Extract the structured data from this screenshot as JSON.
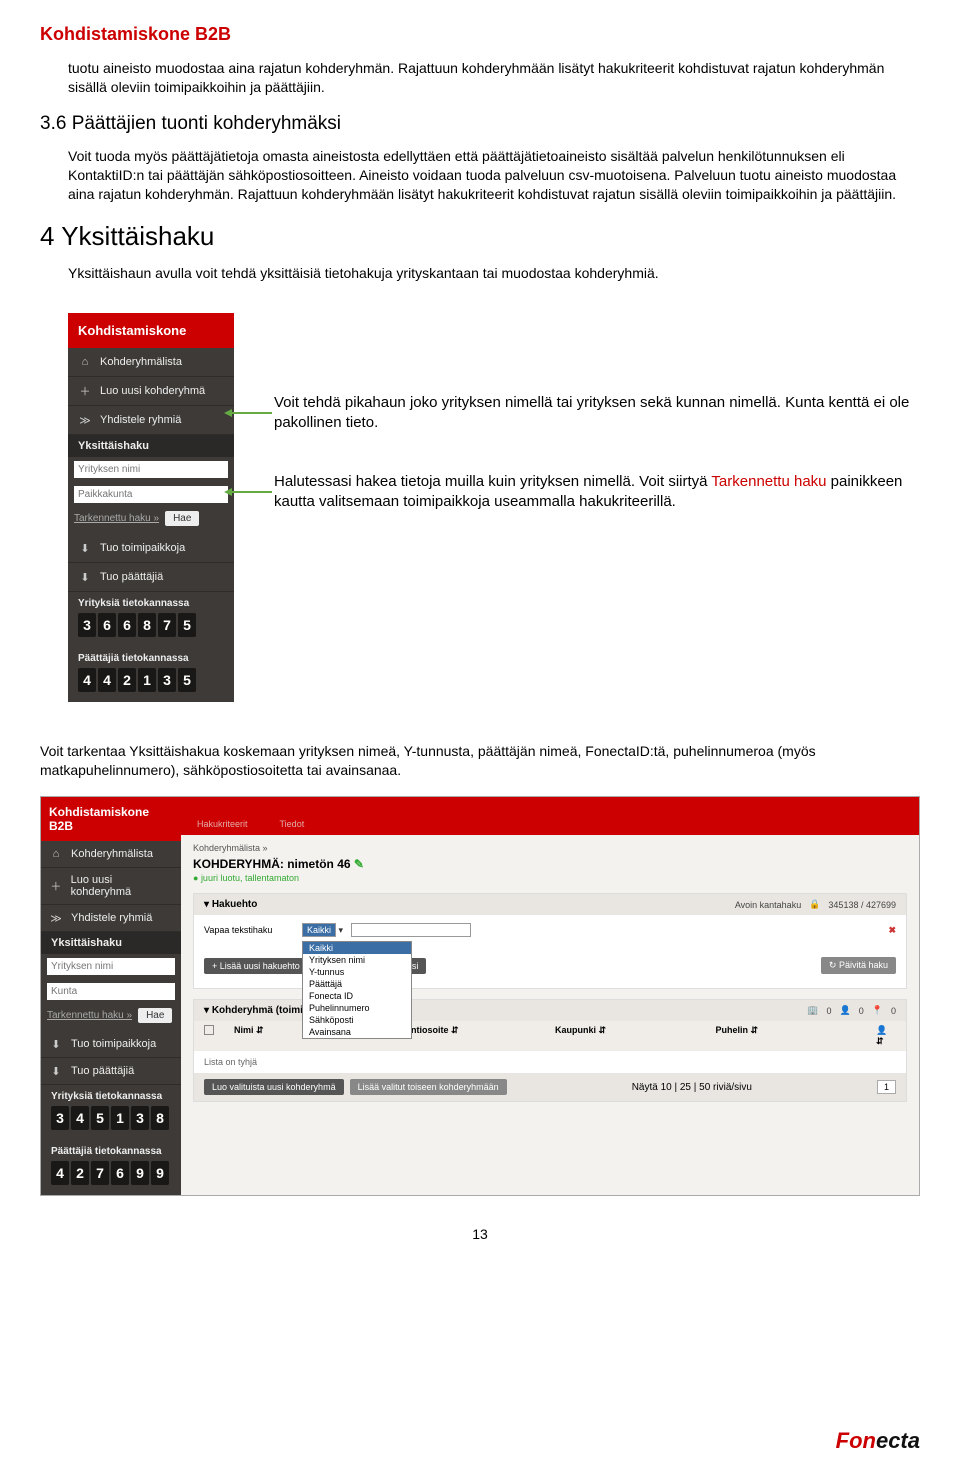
{
  "doc_title": "Kohdistamiskone B2B",
  "para1": "tuotu aineisto muodostaa aina rajatun kohderyhmän. Rajattuun kohderyhmään lisätyt hakukriteerit kohdistuvat rajatun kohderyhmän sisällä oleviin toimipaikkoihin ja päättäjiin.",
  "sec36_title": "3.6 Päättäjien tuonti kohderyhmäksi",
  "para2": "Voit tuoda myös päättäjätietoja omasta aineistosta edellyttäen että päättäjätietoaineisto sisältää palvelun henkilötunnuksen eli KontaktiID:n tai päättäjän sähköpostiosoitteen. Aineisto voidaan tuoda palveluun csv-muotoisena. Palveluun tuotu aineisto muodostaa aina rajatun kohderyhmän. Rajattuun kohderyhmään lisätyt hakukriteerit kohdistuvat rajatun sisällä oleviin toimipaikkoihin ja päättäjiin.",
  "sec4_title": "4 Yksittäishaku",
  "para3": "Yksittäishaun avulla voit tehdä yksittäisiä tietohakuja yrityskantaan tai muodostaa kohderyhmiä.",
  "sidebar": {
    "header": "Kohdistamiskone",
    "items": [
      {
        "icon": "home",
        "label": "Kohderyhmälista"
      },
      {
        "icon": "plus",
        "label": "Luo uusi kohderyhmä"
      },
      {
        "icon": "merge",
        "label": "Yhdistele ryhmiä"
      }
    ],
    "search_label": "Yksittäishaku",
    "input1_placeholder": "Yrityksen nimi",
    "input2_placeholder": "Paikkakunta",
    "adv_link": "Tarkennettu haku »",
    "search_btn": "Hae",
    "items2": [
      {
        "icon": "import",
        "label": "Tuo toimipaikkoja"
      },
      {
        "icon": "import",
        "label": "Tuo päättäjiä"
      }
    ],
    "counter1_label": "Yrityksiä tietokannassa",
    "counter1_digits": [
      "3",
      "6",
      "6",
      "8",
      "7",
      "5"
    ],
    "counter2_label": "Päättäjiä tietokannassa",
    "counter2_digits": [
      "4",
      "4",
      "2",
      "1",
      "3",
      "5"
    ]
  },
  "callout1": "Voit tehdä pikahaun joko yrityksen nimellä tai yrityksen sekä kunnan nimellä. Kunta kenttä ei ole pakollinen tieto.",
  "callout2_a": "Halutessasi hakea tietoja muilla kuin yrityksen nimellä. Voit siirtyä ",
  "callout2_link": "Tarkennettu haku",
  "callout2_b": " painikkeen kautta valitsemaan toimipaikkoja useammalla hakukriteerillä.",
  "para4": "Voit tarkentaa Yksittäishakua koskemaan yrityksen nimeä, Y-tunnusta, päättäjän nimeä, FonectaID:tä, puhelinnumeroa (myös matkapuhelinnumero), sähköpostiosoitetta tai avainsanaa.",
  "app": {
    "header": "Kohdistamiskone B2B",
    "tabs": [
      "Hakukriteerit",
      "Tiedot"
    ],
    "sidebar": {
      "items": [
        {
          "icon": "home",
          "label": "Kohderyhmälista"
        },
        {
          "icon": "plus",
          "label": "Luo uusi kohderyhmä"
        },
        {
          "icon": "merge",
          "label": "Yhdistele ryhmiä"
        }
      ],
      "search_label": "Yksittäishaku",
      "input1_placeholder": "Yrityksen nimi",
      "input2_placeholder": "Kunta",
      "adv_link": "Tarkennettu haku »",
      "search_btn": "Hae",
      "items2": [
        {
          "icon": "import",
          "label": "Tuo toimipaikkoja"
        },
        {
          "icon": "import",
          "label": "Tuo päättäjiä"
        }
      ],
      "counter1_label": "Yrityksiä tietokannassa",
      "counter1_digits": [
        "3",
        "4",
        "5",
        "1",
        "3",
        "8"
      ],
      "counter2_label": "Päättäjiä tietokannassa",
      "counter2_digits": [
        "4",
        "2",
        "7",
        "6",
        "9",
        "9"
      ]
    },
    "crumb": "Kohderyhmälista »",
    "kr_title": "KOHDERYHMÄ: nimetön 46",
    "kr_status": "juuri luotu, tallentamaton",
    "panel1": {
      "title": "Hakuehto",
      "right_label": "Avoin kantahaku",
      "right_val": "345138 / 427699",
      "vapaa_label": "Vapaa tekstihaku",
      "dd_selected": "Kaikki",
      "dd_options": [
        "Kaikki",
        "Yrityksen nimi",
        "Y-tunnus",
        "Päättäjä",
        "Fonecta ID",
        "Puhelinnumero",
        "Sähköposti",
        "Avainsana"
      ],
      "btn_add": "+ Lisää uusi hakuehto",
      "btn_save": "Tallenna kohderyhmäksi",
      "btn_refresh": "Päivitä haku"
    },
    "panel2": {
      "title": "Kohderyhmä (toimipaikat)",
      "stats": [
        "0",
        "0",
        "0"
      ],
      "cols": [
        "Nimi",
        "Käyntiosoite",
        "Kaupunki",
        "Puhelin"
      ],
      "empty": "Lista on tyhjä",
      "foot_btn1": "Luo valituista uusi kohderyhmä",
      "foot_btn2": "Lisää valitut toiseen kohderyhmään",
      "paging_label": "Näytä 10 | 25 | 50 riviä/sivu",
      "page": "1"
    }
  },
  "page_number": "13",
  "footer": {
    "brand1": "Fon",
    "brand2": "ecta"
  }
}
